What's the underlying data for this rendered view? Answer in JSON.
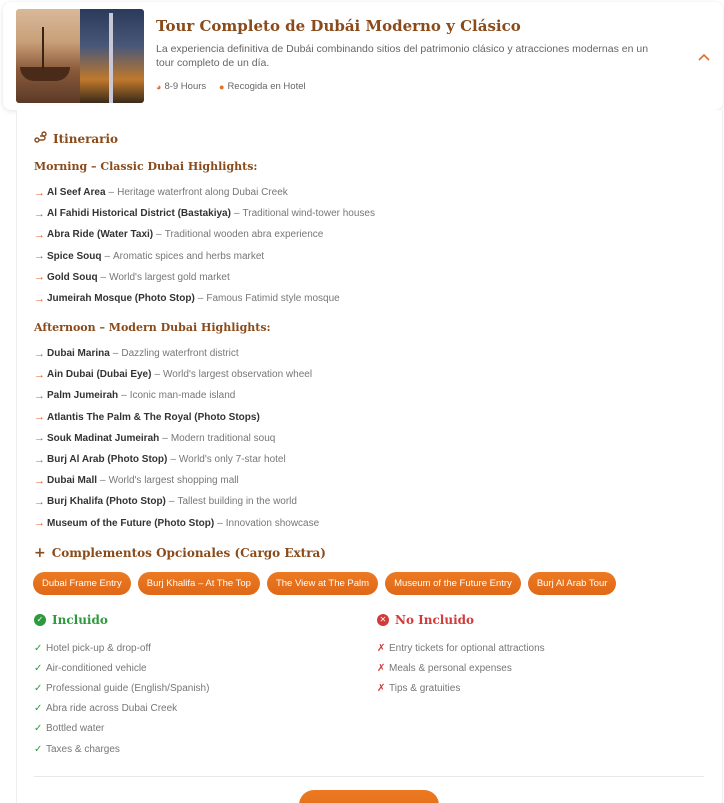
{
  "header": {
    "title": "Tour Completo de Dubái Moderno y Clásico",
    "description": "La experiencia definitiva de Dubái combinando sitios del patrimonio clásico y atracciones modernas en un tour completo de un día.",
    "duration": "8-9 Hours",
    "pickup": "Recogida en Hotel",
    "duration_icon": "clock-icon",
    "pickup_icon": "map-pin-icon",
    "toggle_icon": "chevron-up-icon"
  },
  "itinerary": {
    "title": "Itinerario",
    "icon": "route-icon",
    "morning": {
      "title": "Morning – Classic Dubai Highlights:",
      "stops": [
        {
          "name": "Al Seef Area",
          "desc": "Heritage waterfront along Dubai Creek"
        },
        {
          "name": "Al Fahidi Historical District (Bastakiya)",
          "desc": "Traditional wind-tower houses"
        },
        {
          "name": "Abra Ride (Water Taxi)",
          "desc": "Traditional wooden abra experience"
        },
        {
          "name": "Spice Souq",
          "desc": "Aromatic spices and herbs market"
        },
        {
          "name": "Gold Souq",
          "desc": "World's largest gold market"
        },
        {
          "name": "Jumeirah Mosque (Photo Stop)",
          "desc": "Famous Fatimid style mosque"
        }
      ]
    },
    "afternoon": {
      "title": "Afternoon – Modern Dubai Highlights:",
      "stops": [
        {
          "name": "Dubai Marina",
          "desc": "Dazzling waterfront district"
        },
        {
          "name": "Ain Dubai (Dubai Eye)",
          "desc": "World's largest observation wheel"
        },
        {
          "name": "Palm Jumeirah",
          "desc": "Iconic man-made island"
        },
        {
          "name": "Atlantis The Palm & The Royal (Photo Stops)",
          "desc": ""
        },
        {
          "name": "Souk Madinat Jumeirah",
          "desc": "Modern traditional souq"
        },
        {
          "name": "Burj Al Arab (Photo Stop)",
          "desc": "World's only 7-star hotel"
        },
        {
          "name": "Dubai Mall",
          "desc": "World's largest shopping mall"
        },
        {
          "name": "Burj Khalifa (Photo Stop)",
          "desc": "Tallest building in the world"
        },
        {
          "name": "Museum of the Future (Photo Stop)",
          "desc": "Innovation showcase"
        }
      ]
    }
  },
  "addons": {
    "title": "Complementos Opcionales (Cargo Extra)",
    "icon": "plus-icon",
    "items": [
      "Dubai Frame Entry",
      "Burj Khalifa – At The Top",
      "The View at The Palm",
      "Museum of the Future Entry",
      "Burj Al Arab Tour"
    ]
  },
  "included": {
    "title": "Incluido",
    "icon": "check-circle-icon",
    "items": [
      "Hotel pick-up & drop-off",
      "Air-conditioned vehicle",
      "Professional guide (English/Spanish)",
      "Abra ride across Dubai Creek",
      "Bottled water",
      "Taxes & charges"
    ]
  },
  "not_included": {
    "title": "No Incluido",
    "icon": "x-circle-icon",
    "items": [
      "Entry tickets for optional attractions",
      "Meals & personal expenses",
      "Tips & gratuities"
    ]
  },
  "colors": {
    "accent": "#e06818",
    "title_brown": "#8a4a1a",
    "included_green": "#2e9a3e",
    "excluded_red": "#d33a3a"
  }
}
